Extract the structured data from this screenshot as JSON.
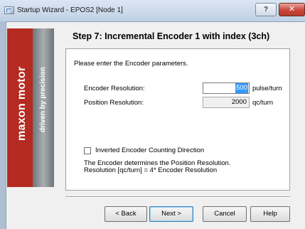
{
  "window": {
    "title": "Startup Wizard - EPOS2 [Node 1]",
    "help_glyph": "?",
    "close_glyph": "✕"
  },
  "brand": {
    "name": "maxon motor",
    "slogan": "driven by precision"
  },
  "step": {
    "title": "Step 7: Incremental Encoder 1 with index (3ch)"
  },
  "form": {
    "prompt": "Please enter the Encoder parameters.",
    "encoder_resolution": {
      "label": "Encoder Resolution:",
      "value": "500",
      "unit": "pulse/turn"
    },
    "position_resolution": {
      "label": "Position Resolution:",
      "value": "2000",
      "unit": "qc/turn"
    },
    "inverted_direction": {
      "label": "Inverted Encoder Counting Direction",
      "checked": false
    },
    "note_line1": "The Encoder determines the Position Resolution.",
    "note_line2": "Resolution [qc/turn] = 4* Encoder Resolution"
  },
  "buttons": {
    "back": "< Back",
    "next": "Next >",
    "cancel": "Cancel",
    "help": "Help"
  }
}
